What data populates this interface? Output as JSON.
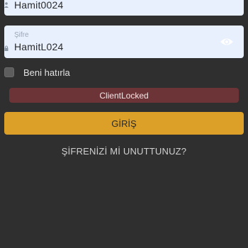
{
  "form": {
    "username": {
      "value": "Hamit0024",
      "icon": "user-icon"
    },
    "password": {
      "label": "Şifre",
      "value": "HamitL024",
      "icon": "lock-icon",
      "toggle_icon": "eye-icon"
    },
    "remember_me": {
      "label": "Beni hatırla",
      "checked": false
    },
    "error_message": "ClientLocked",
    "login_button_label": "GİRİŞ",
    "forgot_password_label": "ŞİFRENİZİ Mİ UNUTTUNUZ?"
  },
  "colors": {
    "background": "#2f2f2f",
    "field_background": "#e8f0fe",
    "error_background": "#6d3438",
    "primary_button": "#dca028",
    "link_text": "#d0d0d0"
  }
}
